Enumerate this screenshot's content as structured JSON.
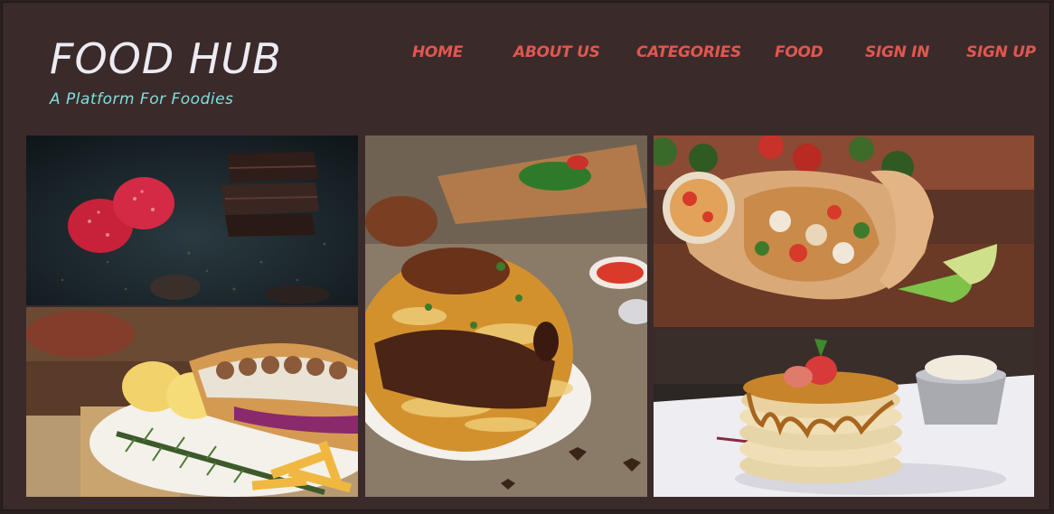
{
  "brand": {
    "title": "FOOD HUB",
    "subtitle": "A Platform For Foodies"
  },
  "nav": {
    "home": "HOME",
    "about": "ABOUT US",
    "categories": "CATEGORIES",
    "food": "FOOD",
    "sign_in": "SIGN IN",
    "sign_up": "SIGN UP"
  },
  "gallery": {
    "images": [
      {
        "id": "chocolate-raspberry",
        "depicts": "chocolate-and-raspberries-photo"
      },
      {
        "id": "sandwich-fries",
        "depicts": "kebab-sandwich-with-fries-photo"
      },
      {
        "id": "biryani",
        "depicts": "chicken-biryani-plate-photo"
      },
      {
        "id": "burrito",
        "depicts": "burrito-wrap-with-lime-photo"
      },
      {
        "id": "pancakes",
        "depicts": "pancake-stack-with-strawberry-photo"
      }
    ]
  },
  "colors": {
    "background": "#3b2a2a",
    "title": "#ecebf3",
    "subtitle": "#7ee0de",
    "nav": "#e0574f"
  }
}
